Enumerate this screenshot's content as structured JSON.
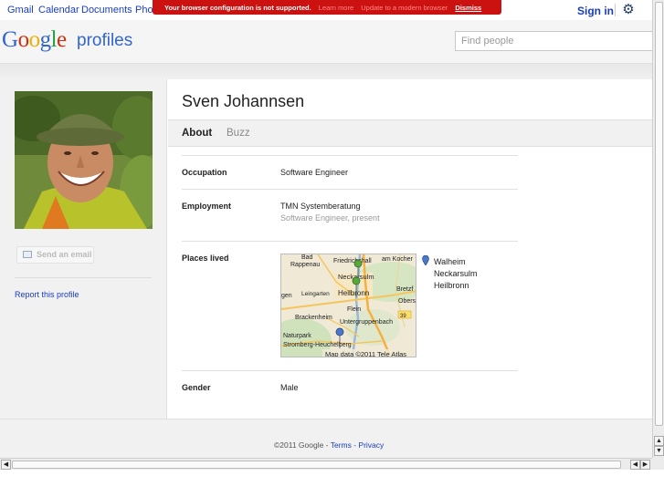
{
  "nav": {
    "links": [
      "Gmail",
      "Calendar",
      "Documents",
      "Pho"
    ],
    "signin": "Sign in"
  },
  "warning": {
    "message": "Your browser configuration is not supported.",
    "learn_more": "Learn more",
    "update": "Update to a modern browser",
    "dismiss": "Dismiss"
  },
  "header": {
    "logo": [
      "G",
      "o",
      "o",
      "g",
      "l",
      "e"
    ],
    "product": "profiles",
    "search_placeholder": "Find people"
  },
  "profile": {
    "name": "Sven Johannsen",
    "send_email": "Send an email",
    "report": "Report this profile"
  },
  "tabs": [
    "About",
    "Buzz"
  ],
  "about": {
    "occupation": {
      "label": "Occupation",
      "value": "Software Engineer"
    },
    "employment": {
      "label": "Employment",
      "company": "TMN Systemberatung",
      "detail": "Software Engineer, present"
    },
    "places": {
      "label": "Places lived",
      "items": [
        "Walheim",
        "Neckarsulm",
        "Heilbronn"
      ],
      "map_labels": [
        "Bad",
        "Rappenau",
        "Friedrichshall",
        "am Kocher",
        "Neckarsulm",
        "Heilbronn",
        "Bretzf",
        "gen",
        "Leingarten",
        "Obers",
        "Flein",
        "Brackenheim",
        "Untergruppenbach",
        "39",
        "Naturpark",
        "Stromberg-Heuchelberg"
      ],
      "map_credit": "Map data ©2011 Tele Atlas"
    },
    "gender": {
      "label": "Gender",
      "value": "Male"
    }
  },
  "footer": {
    "copyright": "©2011 Google",
    "sep": " - ",
    "terms": "Terms",
    "privacy": "Privacy"
  },
  "colors": {
    "link": "#1a3dc1",
    "warning_bg": "#cc1111",
    "panel_bg": "#f1f1f1",
    "pin_green": "#5aa83a",
    "pin_blue": "#4a78c8"
  }
}
